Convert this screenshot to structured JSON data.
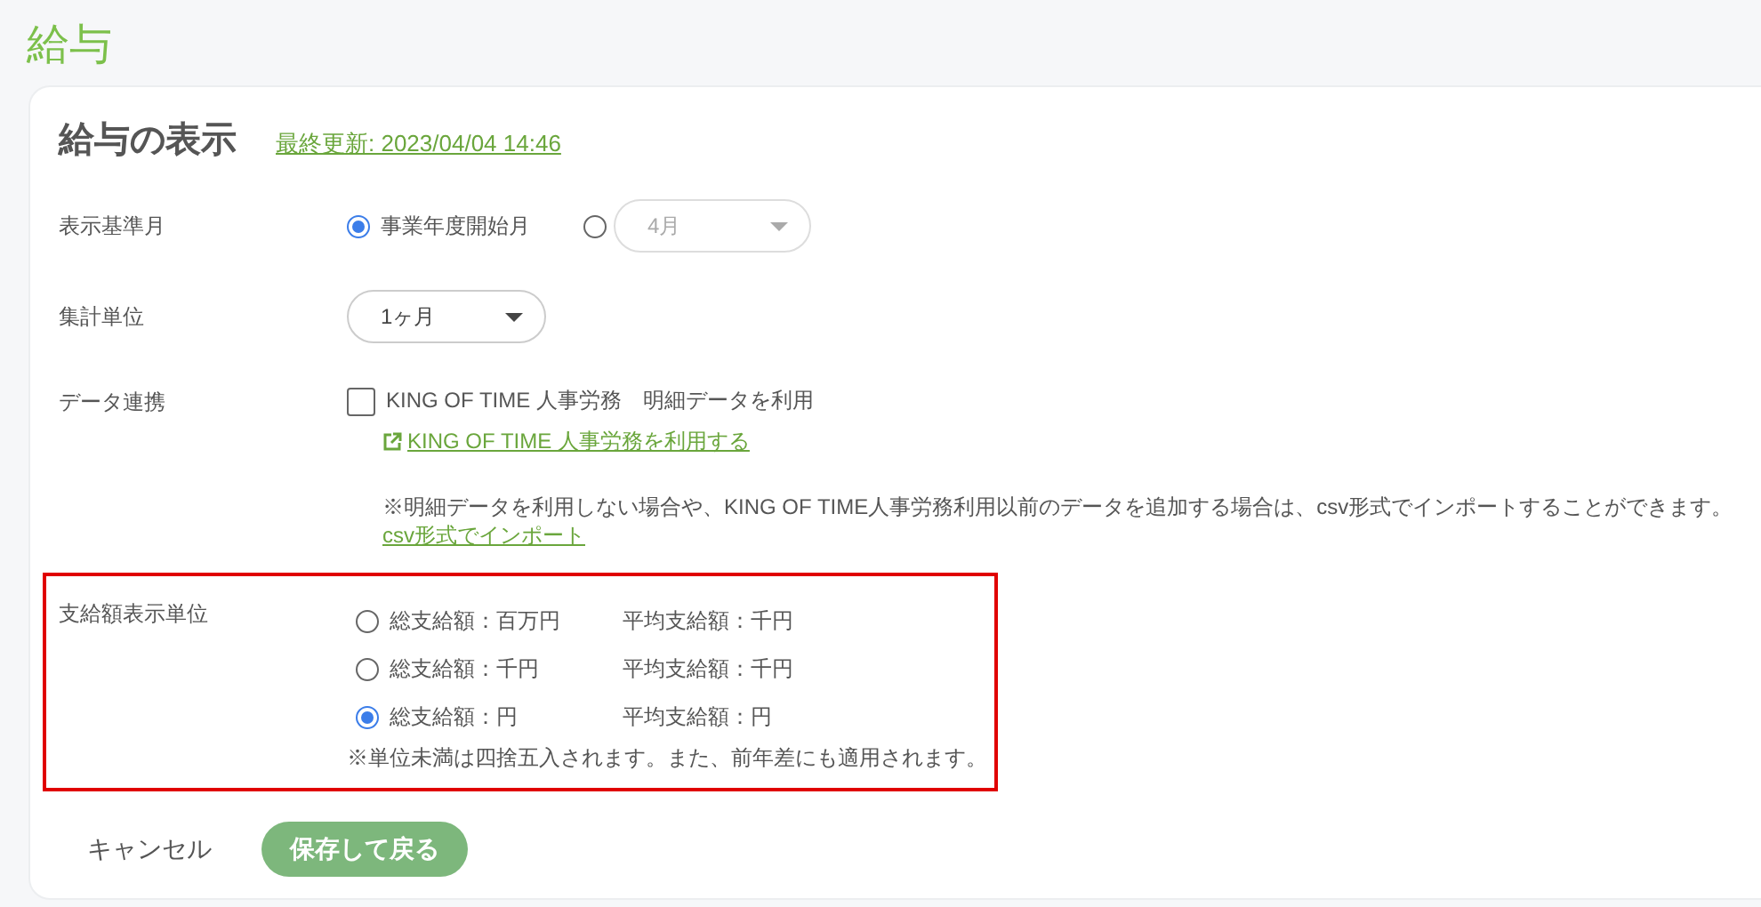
{
  "page_title": "給与",
  "card": {
    "title": "給与の表示",
    "last_updated": "最終更新: 2023/04/04 14:46"
  },
  "base_month": {
    "label": "表示基準月",
    "options": [
      {
        "kind": "text",
        "label": "事業年度開始月",
        "selected": true
      },
      {
        "kind": "select",
        "value": "4月",
        "selected": false,
        "disabled": true
      }
    ]
  },
  "aggregation": {
    "label": "集計単位",
    "value": "1ヶ月"
  },
  "data_link": {
    "label": "データ連携",
    "checkbox": {
      "label": "KING OF TIME 人事労務　明細データを利用",
      "checked": false
    },
    "link": "KING OF TIME 人事労務を利用する",
    "note": "※明細データを利用しない場合や、KING OF TIME人事労務利用以前のデータを追加する場合は、csv形式でインポートすることができます。",
    "import_link": "csv形式でインポート"
  },
  "amount_unit": {
    "label": "支給額表示単位",
    "highlighted": true,
    "options": [
      {
        "total": "総支給額：百万円",
        "average": "平均支給額：千円",
        "selected": false
      },
      {
        "total": "総支給額：千円",
        "average": "平均支給額：千円",
        "selected": false
      },
      {
        "total": "総支給額：円",
        "average": "平均支給額：円",
        "selected": true
      }
    ],
    "note": "※単位未満は四捨五入されます。また、前年差にも適用されます。"
  },
  "buttons": {
    "cancel": "キャンセル",
    "save": "保存して戻る"
  }
}
